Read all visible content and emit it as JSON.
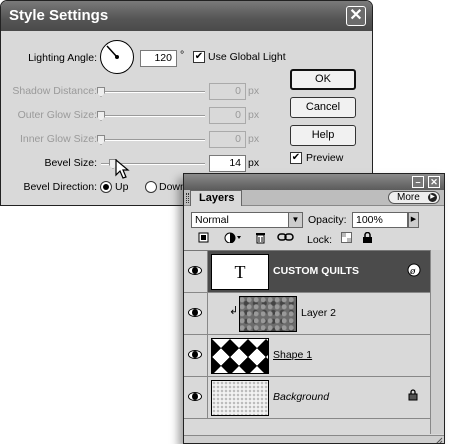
{
  "dialog": {
    "title": "Style Settings",
    "lighting_angle_label": "Lighting Angle:",
    "lighting_angle_value": "120",
    "degree_symbol": "°",
    "use_global_light_label": "Use Global Light",
    "use_global_light_checked": true,
    "rows": [
      {
        "label": "Shadow Distance:",
        "value": "0",
        "unit": "px",
        "enabled": false,
        "level": 0
      },
      {
        "label": "Outer Glow Size:",
        "value": "0",
        "unit": "px",
        "enabled": false,
        "level": 0
      },
      {
        "label": "Inner Glow Size:",
        "value": "0",
        "unit": "px",
        "enabled": false,
        "level": 0
      },
      {
        "label": "Bevel Size:",
        "value": "14",
        "unit": "px",
        "enabled": true,
        "level": 0.1
      }
    ],
    "bevel_direction_label": "Bevel Direction:",
    "bevel_up_label": "Up",
    "bevel_down_label": "Down",
    "bevel_direction_selected": "Up",
    "ok_label": "OK",
    "cancel_label": "Cancel",
    "help_label": "Help",
    "preview_label": "Preview",
    "preview_checked": true,
    "close_glyph": "✕"
  },
  "layers": {
    "tab_label": "Layers",
    "more_label": "More",
    "minimize_glyph": "–",
    "close_glyph": "✕",
    "blend_mode": "Normal",
    "opacity_label": "Opacity:",
    "opacity_value": "100%",
    "lock_label": "Lock:",
    "items": [
      {
        "name": "CUSTOM QUILTS",
        "thumb_text": "T",
        "type": "text",
        "selected": true
      },
      {
        "name": "Layer 2",
        "type": "clipped-texture",
        "selected": false
      },
      {
        "name": "Shape 1",
        "type": "shape",
        "selected": false
      },
      {
        "name": "Background",
        "type": "background",
        "selected": false,
        "locked": true
      }
    ]
  },
  "colors": {
    "dialog_bg": "#d9d9d9",
    "title_bar": "#555555",
    "selected_layer": "#4b4b4b"
  }
}
